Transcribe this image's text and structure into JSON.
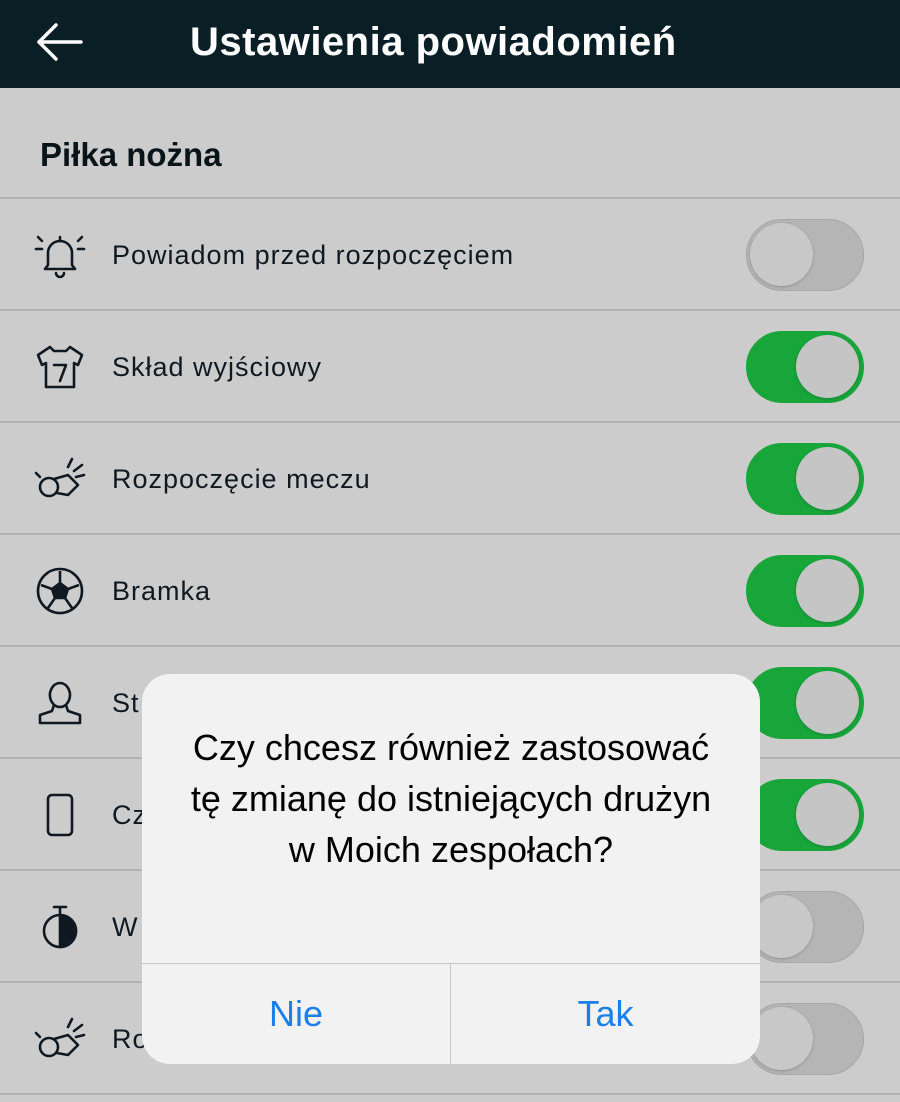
{
  "header": {
    "title": "Ustawienia powiadomień",
    "back_icon": "arrow-left-icon"
  },
  "section": {
    "title": "Piłka nożna"
  },
  "rows": [
    {
      "label": "Powiadom przed rozpoczęciem",
      "icon": "bell-ringing-icon",
      "enabled": false
    },
    {
      "label": "Skład wyjściowy",
      "icon": "jersey-icon",
      "enabled": true
    },
    {
      "label": "Rozpoczęcie meczu",
      "icon": "whistle-icon",
      "enabled": true
    },
    {
      "label": "Bramka",
      "icon": "soccer-ball-icon",
      "enabled": true
    },
    {
      "label": "St",
      "icon": "person-icon",
      "enabled": true
    },
    {
      "label": "Cz",
      "icon": "card-icon",
      "enabled": true
    },
    {
      "label": "W",
      "icon": "stopwatch-icon",
      "enabled": false
    },
    {
      "label": "Ro",
      "icon": "whistle-icon",
      "enabled": false
    }
  ],
  "dialog": {
    "message": "Czy chcesz również zastosować tę zmianę do istniejących drużyn w Moich zespołach?",
    "no_label": "Nie",
    "yes_label": "Tak"
  },
  "colors": {
    "header_bg": "#0a1e26",
    "toggle_on": "#1fd04a",
    "toggle_off": "#e3e3e3",
    "dialog_button": "#1a7fe8"
  }
}
